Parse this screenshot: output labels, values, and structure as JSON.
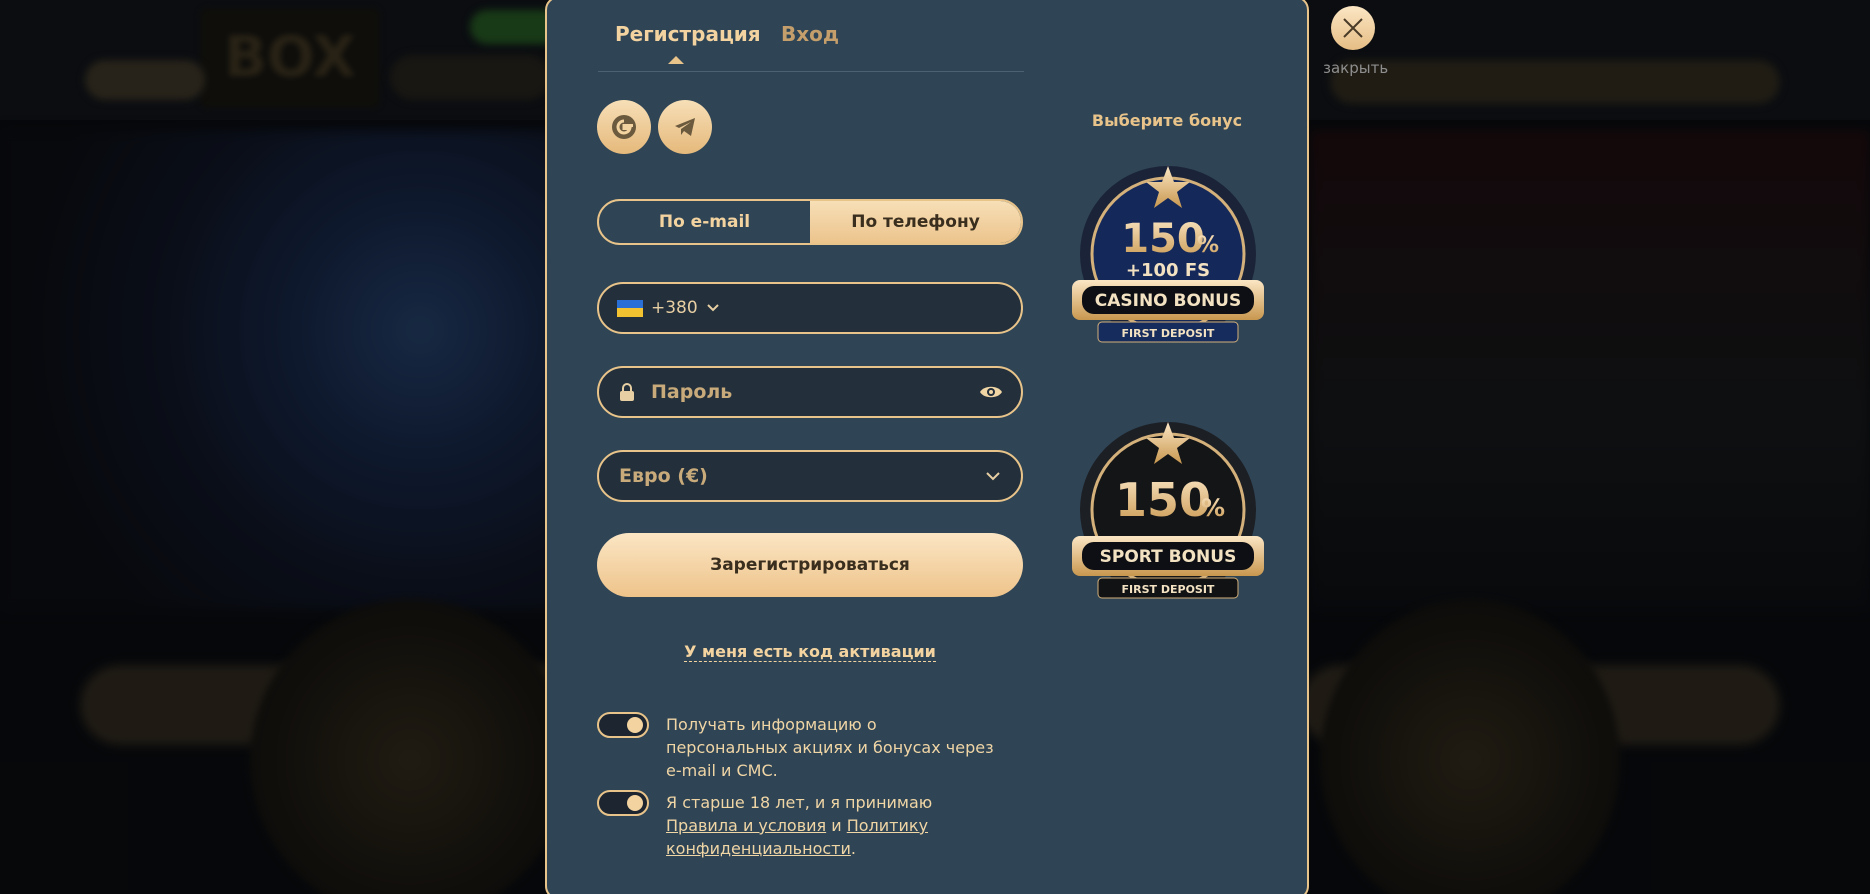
{
  "tabs": {
    "register": "Регистрация",
    "login": "Вход"
  },
  "social": {
    "google": "google-icon",
    "telegram": "telegram-icon"
  },
  "method": {
    "email": "По e-mail",
    "phone": "По телефону",
    "selected": "phone"
  },
  "phone": {
    "flag": "ukraine-flag",
    "code": "+380",
    "value": ""
  },
  "password": {
    "placeholder": "Пароль"
  },
  "currency": {
    "value": "Евро (€)"
  },
  "submit_label": "Зарегистрироваться",
  "activation_code_link": "У меня есть код активации",
  "consents": {
    "promo": {
      "text": "Получать информацию о персональных акциях и бонусах через e-mail и СМС.",
      "checked": true
    },
    "terms": {
      "prefix": "Я старше 18 лет, и я принимаю ",
      "rules_link": "Правила и условия",
      "and": " и ",
      "privacy_link": "Политику конфиденциальности",
      "suffix": ".",
      "checked": true
    }
  },
  "bonus": {
    "title": "Выберите бонус",
    "casino": {
      "percent": "150",
      "pct_sign": "%",
      "extra": "+100 FS",
      "ribbon": "CASINO BONUS",
      "sub": "FIRST DEPOSIT"
    },
    "sport": {
      "percent": "150",
      "pct_sign": "%",
      "ribbon": "SPORT BONUS",
      "sub": "FIRST DEPOSIT"
    }
  },
  "close_label": "закрыть",
  "colors": {
    "accent": "#e9c48a",
    "modal_bg": "#2f4556",
    "field_bg": "#232f3b"
  }
}
